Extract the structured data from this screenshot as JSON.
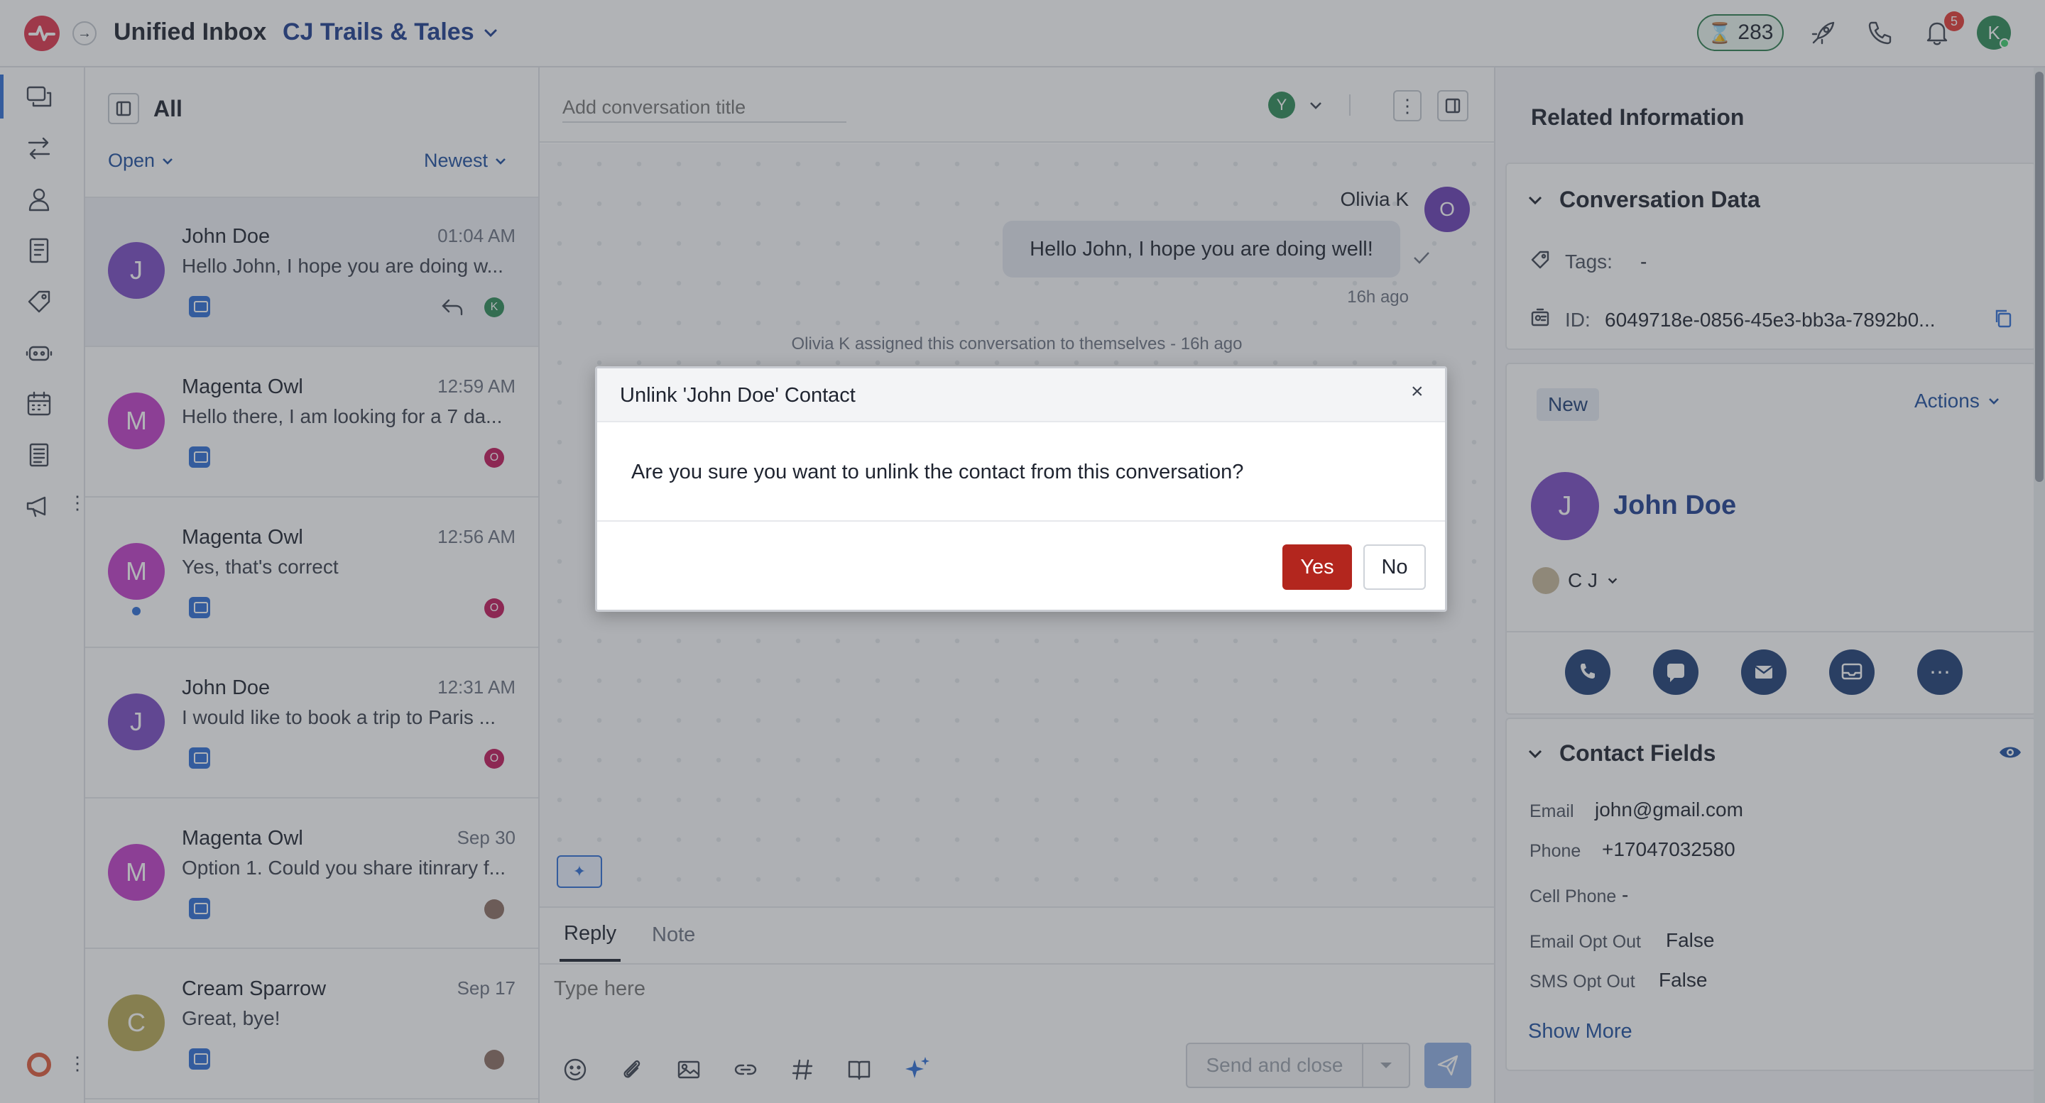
{
  "topbar": {
    "title": "Unified Inbox",
    "workspace": "CJ Trails & Tales",
    "credits": "283",
    "notif_count": "5",
    "avatar_letter": "K"
  },
  "list": {
    "filter_title": "All",
    "status_filter": "Open",
    "sort": "Newest",
    "items": [
      {
        "initial": "J",
        "name": "John Doe",
        "time": "01:04 AM",
        "preview": "Hello John, I hope you are doing w...",
        "avatar_color": "#7b4bc4",
        "mini": "K",
        "mini_color": "#2e8b57"
      },
      {
        "initial": "M",
        "name": "Magenta Owl",
        "time": "12:59 AM",
        "preview": "Hello there, I am looking for a 7 da...",
        "avatar_color": "#c13ec9",
        "mini": "O",
        "mini_color": "#c2185b"
      },
      {
        "initial": "M",
        "name": "Magenta Owl",
        "time": "12:56 AM",
        "preview": "Yes, that's correct",
        "avatar_color": "#c13ec9",
        "mini": "O",
        "mini_color": "#c2185b"
      },
      {
        "initial": "J",
        "name": "John Doe",
        "time": "12:31 AM",
        "preview": "I would like to book a trip to Paris ...",
        "avatar_color": "#7b4bc4",
        "mini": "O",
        "mini_color": "#c2185b"
      },
      {
        "initial": "M",
        "name": "Magenta Owl",
        "time": "Sep 30",
        "preview": "Option 1. Could you share itinrary f...",
        "avatar_color": "#c13ec9",
        "mini": "",
        "mini_color": "#8d6e63"
      },
      {
        "initial": "C",
        "name": "Cream Sparrow",
        "time": "Sep 17",
        "preview": "Great, bye!",
        "avatar_color": "#b7a955",
        "mini": "",
        "mini_color": "#8d6e63"
      }
    ]
  },
  "center": {
    "title_placeholder": "Add conversation title",
    "assignee_letter": "Y",
    "sender": "Olivia K",
    "sender_initial": "O",
    "message": "Hello John, I hope you are doing well!",
    "message_time": "16h ago",
    "system_note": "Olivia K assigned this conversation to themselves - 16h ago",
    "tab_reply": "Reply",
    "tab_note": "Note",
    "composer_placeholder": "Type here",
    "send_label": "Send and close"
  },
  "right": {
    "header": "Related Information",
    "conv_data_title": "Conversation Data",
    "tags_label": "Tags:",
    "tags_value": "-",
    "id_label": "ID:",
    "id_value": "6049718e-0856-45e3-bb3a-7892b0...",
    "status_badge": "New",
    "actions_label": "Actions",
    "contact_initial": "J",
    "contact_name": "John Doe",
    "owner": "C J",
    "contact_fields_title": "Contact Fields",
    "fields": [
      {
        "label": "Email",
        "value": "john@gmail.com"
      },
      {
        "label": "Phone",
        "value": "+17047032580"
      },
      {
        "label": "Cell Phone",
        "value": "-"
      },
      {
        "label": "Email Opt Out",
        "value": "False"
      },
      {
        "label": "SMS Opt Out",
        "value": "False"
      }
    ],
    "show_more": "Show More"
  },
  "modal": {
    "title": "Unlink 'John Doe' Contact",
    "message": "Are you sure you want to unlink the contact from this conversation?",
    "yes": "Yes",
    "no": "No"
  }
}
